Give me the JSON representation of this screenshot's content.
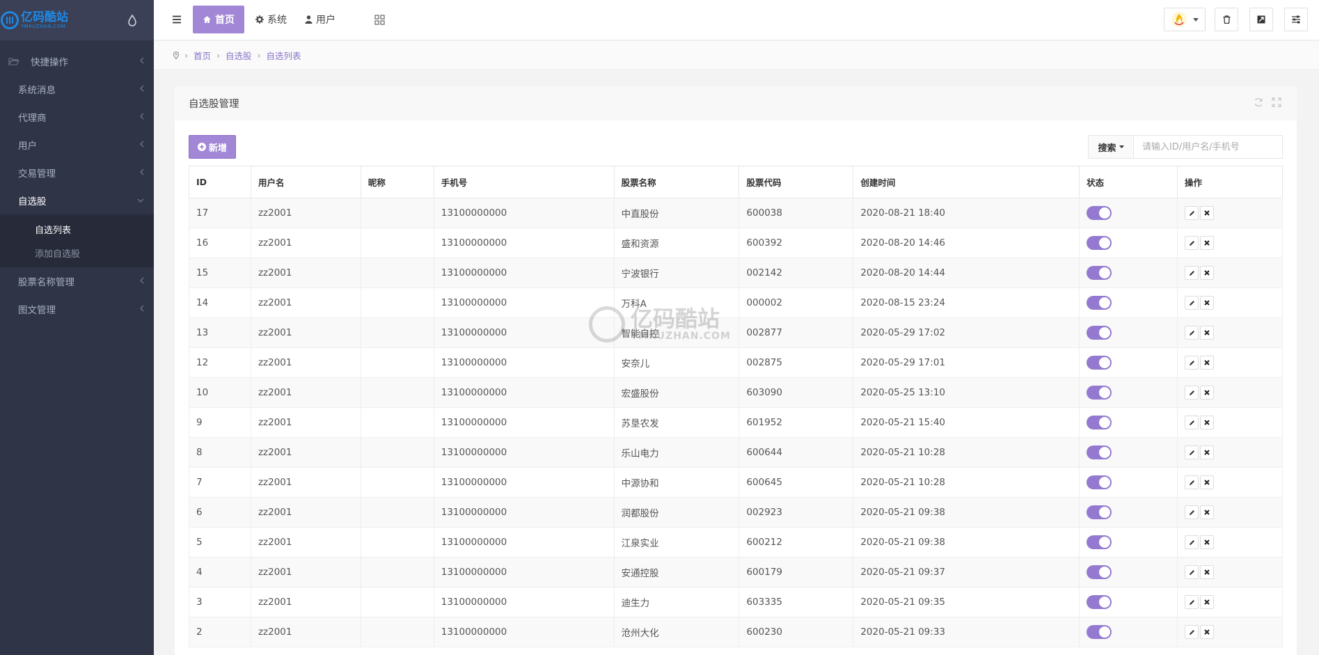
{
  "logo": {
    "cn": "亿码酷站",
    "en": "YMKUZHAN.COM"
  },
  "sidebar": {
    "items": [
      {
        "label": "快捷操作"
      },
      {
        "label": "系统消息"
      },
      {
        "label": "代理商"
      },
      {
        "label": "用户"
      },
      {
        "label": "交易管理"
      },
      {
        "label": "自选股"
      },
      {
        "label": "股票名称管理"
      },
      {
        "label": "图文管理"
      }
    ],
    "subitems": [
      {
        "label": "自选列表"
      },
      {
        "label": "添加自选股"
      }
    ]
  },
  "topnav": {
    "tabs": [
      {
        "label": "首页"
      },
      {
        "label": "系统"
      },
      {
        "label": "用户"
      }
    ]
  },
  "breadcrumb": [
    "首页",
    "自选股",
    "自选列表"
  ],
  "card": {
    "title": "自选股管理",
    "add_label": "新增",
    "search_label": "搜索",
    "search_placeholder": "请输入ID/用户名/手机号"
  },
  "table": {
    "headers": [
      "ID",
      "用户名",
      "昵称",
      "手机号",
      "股票名称",
      "股票代码",
      "创建时间",
      "状态",
      "操作"
    ],
    "rows": [
      {
        "id": "17",
        "user": "zz2001",
        "nick": "",
        "phone": "13100000000",
        "stock": "中直股份",
        "code": "600038",
        "time": "2020-08-21 18:40"
      },
      {
        "id": "16",
        "user": "zz2001",
        "nick": "",
        "phone": "13100000000",
        "stock": "盛和资源",
        "code": "600392",
        "time": "2020-08-20 14:46"
      },
      {
        "id": "15",
        "user": "zz2001",
        "nick": "",
        "phone": "13100000000",
        "stock": "宁波银行",
        "code": "002142",
        "time": "2020-08-20 14:44"
      },
      {
        "id": "14",
        "user": "zz2001",
        "nick": "",
        "phone": "13100000000",
        "stock": "万科A",
        "code": "000002",
        "time": "2020-08-15 23:24"
      },
      {
        "id": "13",
        "user": "zz2001",
        "nick": "",
        "phone": "13100000000",
        "stock": "智能自控",
        "code": "002877",
        "time": "2020-05-29 17:02"
      },
      {
        "id": "12",
        "user": "zz2001",
        "nick": "",
        "phone": "13100000000",
        "stock": "安奈儿",
        "code": "002875",
        "time": "2020-05-29 17:01"
      },
      {
        "id": "10",
        "user": "zz2001",
        "nick": "",
        "phone": "13100000000",
        "stock": "宏盛股份",
        "code": "603090",
        "time": "2020-05-25 13:10"
      },
      {
        "id": "9",
        "user": "zz2001",
        "nick": "",
        "phone": "13100000000",
        "stock": "苏垦农发",
        "code": "601952",
        "time": "2020-05-21 15:40"
      },
      {
        "id": "8",
        "user": "zz2001",
        "nick": "",
        "phone": "13100000000",
        "stock": "乐山电力",
        "code": "600644",
        "time": "2020-05-21 10:28"
      },
      {
        "id": "7",
        "user": "zz2001",
        "nick": "",
        "phone": "13100000000",
        "stock": "中源协和",
        "code": "600645",
        "time": "2020-05-21 10:28"
      },
      {
        "id": "6",
        "user": "zz2001",
        "nick": "",
        "phone": "13100000000",
        "stock": "润都股份",
        "code": "002923",
        "time": "2020-05-21 09:38"
      },
      {
        "id": "5",
        "user": "zz2001",
        "nick": "",
        "phone": "13100000000",
        "stock": "江泉实业",
        "code": "600212",
        "time": "2020-05-21 09:38"
      },
      {
        "id": "4",
        "user": "zz2001",
        "nick": "",
        "phone": "13100000000",
        "stock": "安通控股",
        "code": "600179",
        "time": "2020-05-21 09:37"
      },
      {
        "id": "3",
        "user": "zz2001",
        "nick": "",
        "phone": "13100000000",
        "stock": "迪生力",
        "code": "603335",
        "time": "2020-05-21 09:35"
      },
      {
        "id": "2",
        "user": "zz2001",
        "nick": "",
        "phone": "13100000000",
        "stock": "沧州大化",
        "code": "600230",
        "time": "2020-05-21 09:33"
      }
    ]
  },
  "watermark": {
    "cn": "亿码酷站",
    "en": "YMKUZHAN.COM"
  },
  "colors": {
    "accent": "#a287d6",
    "sidebar": "#2f3447",
    "logo": "#1e88e5"
  }
}
